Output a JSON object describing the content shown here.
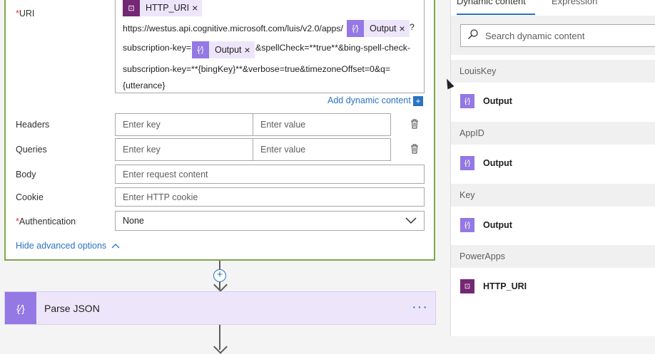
{
  "http_card": {
    "uri_label": "URI",
    "required_mark": "*",
    "uri_tokens": {
      "http_uri": "HTTP_URI",
      "output1": "Output",
      "output2": "Output",
      "remove": "×"
    },
    "uri_text": {
      "line1": "https://westus.api.cognitive.microsoft.com/luis/v2.0/apps/",
      "line1_end": "?",
      "line2_start": "subscription-key=",
      "line2_end": "&spellCheck=**true**&bing-spell-check-",
      "line3": "subscription-key=**{bingKey}**&verbose=true&timezoneOffset=0&q=",
      "line4": "{utterance}"
    },
    "add_dynamic_content": "Add dynamic content",
    "add_dynamic_plus": "+",
    "headers_label": "Headers",
    "queries_label": "Queries",
    "body_label": "Body",
    "cookie_label": "Cookie",
    "auth_label": "Authentication",
    "key_placeholder": "Enter key",
    "value_placeholder": "Enter value",
    "body_placeholder": "Enter request content",
    "cookie_placeholder": "Enter HTTP cookie",
    "auth_value": "None",
    "hide_advanced": "Hide advanced options",
    "chevron_up": "^"
  },
  "connector": {
    "plus": "+"
  },
  "parse_json": {
    "title": "Parse JSON",
    "more": "···",
    "icon_glyph": "{⁄}"
  },
  "panel": {
    "tab_dynamic": "Dynamic content",
    "tab_expression": "Expression",
    "search_placeholder": "Search dynamic content",
    "groups": [
      {
        "name": "LouisKey",
        "item": "Output"
      },
      {
        "name": "AppID",
        "item": "Output"
      },
      {
        "name": "Key",
        "item": "Output"
      },
      {
        "name": "PowerApps",
        "item": "HTTP_URI"
      }
    ]
  },
  "colors": {
    "accent": "#2b73c0",
    "variable_purple": "#9478e4",
    "powerapps_purple": "#742774",
    "card_border_green": "#7fa650"
  }
}
